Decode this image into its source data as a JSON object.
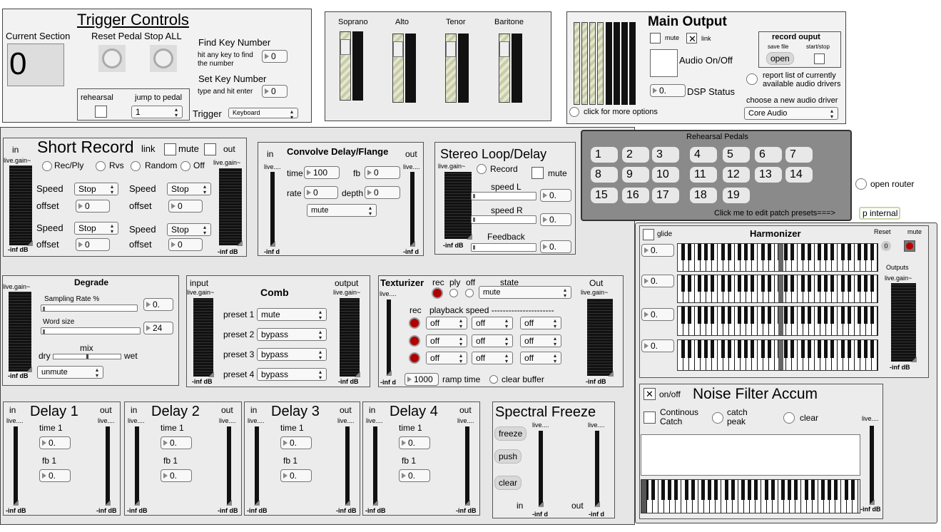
{
  "trigger": {
    "title": "Trigger Controls",
    "current_section_label": "Current Section",
    "current_section_value": "0",
    "reset_pedal_label": "Reset Pedal",
    "stop_all_label": "Stop ALL",
    "find_key_title": "Find Key Number",
    "find_key_hint": "hit any key to find the number",
    "find_key_value": "0",
    "set_key_title": "Set Key Number",
    "set_key_hint": "type and hit enter",
    "set_key_value": "0",
    "rehearsal_label": "rehearsal",
    "jump_label": "jump to pedal",
    "jump_value": "1",
    "trigger_label": "Trigger",
    "trigger_value": "Keyboard"
  },
  "voices": [
    "Soprano",
    "Alto",
    "Tenor",
    "Baritone"
  ],
  "main_output": {
    "title": "Main Output",
    "mute_label": "mute",
    "link_label": "link",
    "audio_onoff_label": "Audio On/Off",
    "dsp_value": "0.",
    "dsp_label": "DSP Status",
    "more_options_label": "click for more options",
    "record_output_title": "record ouput",
    "save_file_label": "save file",
    "start_stop_label": "start/stop",
    "open_label": "open",
    "report_label": "report list of currently available audio drivers",
    "choose_driver_label": "choose a new audio driver",
    "driver_value": "Core Audio"
  },
  "short_record": {
    "title": "Short Record",
    "in_label": "in",
    "out_label": "out",
    "link_label": "link",
    "mute_label": "mute",
    "gain_label": "live.gain~",
    "db_label": "-inf dB",
    "modes": [
      "Rec/Ply",
      "Rvs",
      "Random",
      "Off"
    ],
    "speed_label": "Speed",
    "offset_label": "offset",
    "speed_value": "Stop",
    "offset_value": "0"
  },
  "convolve": {
    "title": "Convolve Delay/Flange",
    "in_label": "in",
    "out_label": "out",
    "live_label": "live....",
    "time_label": "time",
    "time_value": "100",
    "fb_label": "fb",
    "fb_value": "0",
    "rate_label": "rate",
    "rate_value": "0",
    "depth_label": "depth",
    "depth_value": "0",
    "mode_value": "mute",
    "db_label": "-inf d"
  },
  "stereo_loop": {
    "title": "Stereo Loop/Delay",
    "gain_label": "live.gain~",
    "record_label": "Record",
    "mute_label": "mute",
    "speed_l_label": "speed L",
    "speed_l_value": "0.",
    "speed_r_label": "speed R",
    "speed_r_value": "0.",
    "feedback_label": "Feedback",
    "feedback_value": "0.",
    "db_label": "-inf dB"
  },
  "rehearsal_pedals": {
    "title": "Rehearsal Pedals",
    "pedals": [
      "1",
      "2",
      "3",
      "4",
      "5",
      "6",
      "7",
      "8",
      "9",
      "10",
      "11",
      "12",
      "13",
      "14",
      "15",
      "16",
      "17",
      "18",
      "19"
    ],
    "edit_label": "Click me to edit patch presets===>"
  },
  "router": {
    "open_router_label": "open router",
    "p_internal_label": "p internal"
  },
  "degrade": {
    "title": "Degrade",
    "gain_label": "live.gain~",
    "sampling_label": "Sampling Rate %",
    "sampling_value": "0.",
    "word_size_label": "Word size",
    "word_size_value": "24",
    "mix_label": "mix",
    "dry_label": "dry",
    "wet_label": "wet",
    "mute_value": "unmute",
    "db_label": "-inf dB"
  },
  "comb": {
    "title": "Comb",
    "input_label": "input",
    "output_label": "output",
    "gain_label": "live.gain~",
    "presets": [
      {
        "label": "preset 1",
        "value": "mute"
      },
      {
        "label": "preset 2",
        "value": "bypass"
      },
      {
        "label": "preset 3",
        "value": "bypass"
      },
      {
        "label": "preset 4",
        "value": "bypass"
      }
    ],
    "db_label": "-inf dB"
  },
  "texturizer": {
    "title": "Texturizer",
    "rec_label": "rec",
    "ply_label": "ply",
    "off_label": "off",
    "state_label": "state",
    "state_value": "mute",
    "out_label": "Out",
    "live_label": "live....",
    "gain_label": "live.gain~",
    "playback_label": "playback speed ----------------------",
    "speed_value": "off",
    "ramp_value": "1000",
    "ramp_label": "ramp time",
    "clear_label": "clear buffer",
    "db_label": "-inf d",
    "db_out_label": "-inf dB"
  },
  "harmonizer": {
    "title": "Harmonizer",
    "glide_label": "glide",
    "reset_label": "Reset",
    "mute_label": "mute",
    "reset_value": "0",
    "outputs_label": "Outputs",
    "gain_label": "live.gain~",
    "values": [
      "0.",
      "0.",
      "0.",
      "0."
    ],
    "db_label": "-inf dB"
  },
  "delays": [
    {
      "title": "Delay 1",
      "in_label": "in",
      "out_label": "out",
      "live_label": "live....",
      "time_label": "time 1",
      "time_value": "0.",
      "fb_label": "fb 1",
      "fb_value": "0.",
      "db_label": "-inf dB"
    },
    {
      "title": "Delay 2",
      "in_label": "in",
      "out_label": "out",
      "live_label": "live....",
      "time_label": "time 1",
      "time_value": "0.",
      "fb_label": "fb 1",
      "fb_value": "0.",
      "db_label": "-inf dB"
    },
    {
      "title": "Delay 3",
      "in_label": "in",
      "out_label": "out",
      "live_label": "live....",
      "time_label": "time 1",
      "time_value": "0.",
      "fb_label": "fb 1",
      "fb_value": "0.",
      "db_label": "-inf dB"
    },
    {
      "title": "Delay 4",
      "in_label": "in",
      "out_label": "out",
      "live_label": "live....",
      "time_label": "time 1",
      "time_value": "0.",
      "fb_label": "fb 1",
      "fb_value": "0.",
      "db_label": "-inf dB"
    }
  ],
  "spectral_freeze": {
    "title": "Spectral Freeze",
    "freeze_label": "freeze",
    "push_label": "push",
    "clear_label": "clear",
    "live_label": "live....",
    "in_label": "in",
    "out_label": "out",
    "db_label": "-inf d"
  },
  "noise_filter": {
    "title": "Noise Filter Accum",
    "onoff_label": "on/off",
    "continous_label": "Continous Catch",
    "catch_peak_label": "catch peak",
    "clear_label": "clear",
    "live_label": "live....",
    "db_label": "-inf dB"
  }
}
